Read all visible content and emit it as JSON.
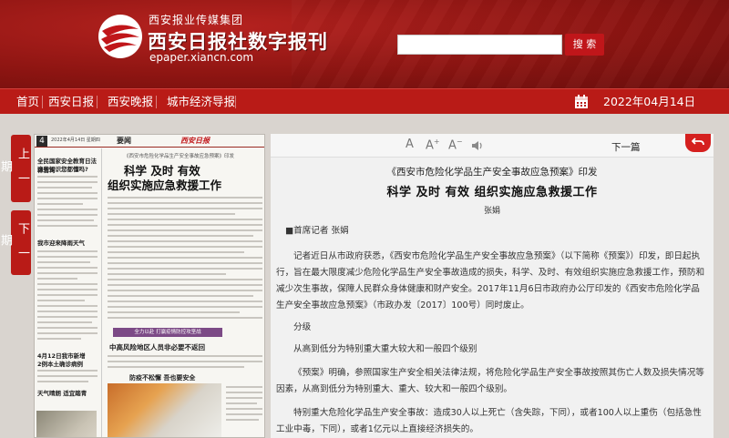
{
  "header": {
    "group_name": "西安报业传媒集团",
    "site_title": "西安日报社数字报刊",
    "url": "epaper.xiancn.com",
    "search_placeholder": "",
    "search_button": "搜 索"
  },
  "nav": {
    "items": [
      "首页",
      "西安日报",
      "西安晚报",
      "城市经济导报"
    ],
    "date": "2022年04月14日"
  },
  "side": {
    "prev": "上一期",
    "next": "下一期"
  },
  "paper_page": {
    "page_no": "4",
    "info": "2022年4月14日 星期四",
    "section": "要闻",
    "masthead": "西安日报",
    "deck": "《西安市危险化学品生产安全事故应急预案》印发",
    "title_line1": "科学 及时 有效",
    "title_line2": "组织实施应急救援工作",
    "left_headline_1": "全民国家安全教育日法律咨询",
    "left_headline_2": "这些知识您都懂吗?",
    "left_headline_3": "我市迎来降雨天气",
    "left_headline_4": "4月12日我市新增",
    "left_headline_5": "2例本土确诊病例",
    "left_headline_6": "天气晴朗 适宜踏青",
    "banner": "全力以赴 打赢疫情防控攻坚战",
    "mid_headline_1": "中高风险地区人员非必要不返回",
    "mid_headline_2": "防疫不松懈 吾也要安全"
  },
  "toolbar": {
    "font_normal": "A",
    "font_larger": "A",
    "font_smaller": "A",
    "next_article": "下一篇"
  },
  "article": {
    "pre_title": "《西安市危险化学品生产安全事故应急预案》印发",
    "title": "科学 及时 有效 组织实施应急救援工作",
    "author": "张娟",
    "byline": "■首席记者 张娟",
    "para1": "记者近日从市政府获悉，《西安市危险化学品生产安全事故应急预案》（以下简称《预案》）印发，即日起执行，旨在最大限度减少危险化学品生产安全事故造成的损失，科学、及时、有效组织实施应急救援工作，预防和减少次生事故，保障人民群众身体健康和财产安全。2017年11月6日市政府办公厅印发的《西安市危险化学品生产安全事故应急预案》（市政办发〔2017〕100号）同时废止。",
    "para2": "分级",
    "para3": "从高到低分为特别重大重大较大和一般四个级别",
    "para4": "《预案》明确，参照国家生产安全相关法律法规，将危险化学品生产安全事故按照其伤亡人数及损失情况等因素，从高到低分为特别重大、重大、较大和一般四个级别。",
    "para5": "特别重大危险化学品生产安全事故：造成30人以上死亡（含失踪，下同），或者100人以上重伤（包括急性工业中毒，下同），或者1亿元以上直接经济损失的。"
  },
  "colors": {
    "brand_red": "#b91b17",
    "header_red": "#8e1512",
    "button_red": "#c0161a"
  }
}
